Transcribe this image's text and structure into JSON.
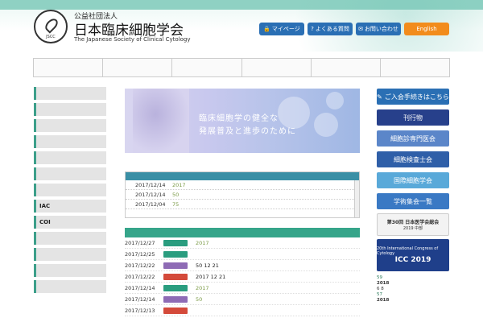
{
  "header": {
    "org_kind": "公益社団法人",
    "org_name": "日本臨床細胞学会",
    "org_en": "The Japanese Society of Clinical Cytology",
    "logo_text": "JSCC",
    "buttons": [
      {
        "label": "マイページ",
        "icon": "lock-icon"
      },
      {
        "label": "よくある質問",
        "icon": "question-icon"
      },
      {
        "label": "お問い合わせ",
        "icon": "mail-icon"
      },
      {
        "label": "English"
      }
    ]
  },
  "gnav": [
    "",
    "",
    "",
    "",
    "",
    ""
  ],
  "sidebar": [
    {
      "label": ""
    },
    {
      "label": ""
    },
    {
      "label": ""
    },
    {
      "label": ""
    },
    {
      "label": ""
    },
    {
      "label": ""
    },
    {
      "label": ""
    },
    {
      "label": "IAC"
    },
    {
      "label": "COI"
    },
    {
      "label": ""
    },
    {
      "label": ""
    },
    {
      "label": ""
    },
    {
      "label": ""
    }
  ],
  "hero": {
    "line1": "臨床細胞学の健全な",
    "line2": "発展普及と進歩のために"
  },
  "topics": {
    "rows": [
      {
        "date": "2017/12/14",
        "text": "2017"
      },
      {
        "date": "2017/12/14",
        "text": "50"
      },
      {
        "date": "2017/12/04",
        "text": "75"
      }
    ]
  },
  "news": {
    "rows": [
      {
        "date": "2017/12/27",
        "badge": "",
        "badge_color": "#2a9d7f",
        "text": "2017"
      },
      {
        "date": "2017/12/25",
        "badge": "",
        "badge_color": "#2a9d7f",
        "text": ""
      },
      {
        "date": "2017/12/22",
        "badge": "",
        "badge_color": "#8e6bb5",
        "text": "50 12 21"
      },
      {
        "date": "2017/12/22",
        "badge": "",
        "badge_color": "#d44a3a",
        "text": "2017 12 21"
      },
      {
        "date": "2017/12/14",
        "badge": "",
        "badge_color": "#2a9d7f",
        "text": "2017"
      },
      {
        "date": "2017/12/14",
        "badge": "",
        "badge_color": "#8e6bb5",
        "text": "50"
      },
      {
        "date": "2017/12/13",
        "badge": "",
        "badge_color": "#d44a3a",
        "text": ""
      }
    ]
  },
  "right": {
    "banners": [
      {
        "label": "ご入会手続きはこちら",
        "color": "#2a6fb4"
      },
      {
        "label": "刊行物",
        "color": "#27408b"
      },
      {
        "label": "細胞診専門医会",
        "color": "#5b86c9"
      },
      {
        "label": "細胞検査士会",
        "color": "#2f5fa8"
      },
      {
        "label": "国際細胞学会",
        "color": "#59a9d9"
      },
      {
        "label": "学術集会一覧",
        "color": "#3a79c4"
      }
    ],
    "ad1": {
      "title": "第30回 日本医学会総会",
      "sub": "2019 中部"
    },
    "ad2": {
      "title": "20th International Congress of Cytology",
      "sub": "ICC 2019"
    },
    "notes": [
      "59",
      "2018",
      "6 8",
      "57",
      "2018"
    ]
  }
}
